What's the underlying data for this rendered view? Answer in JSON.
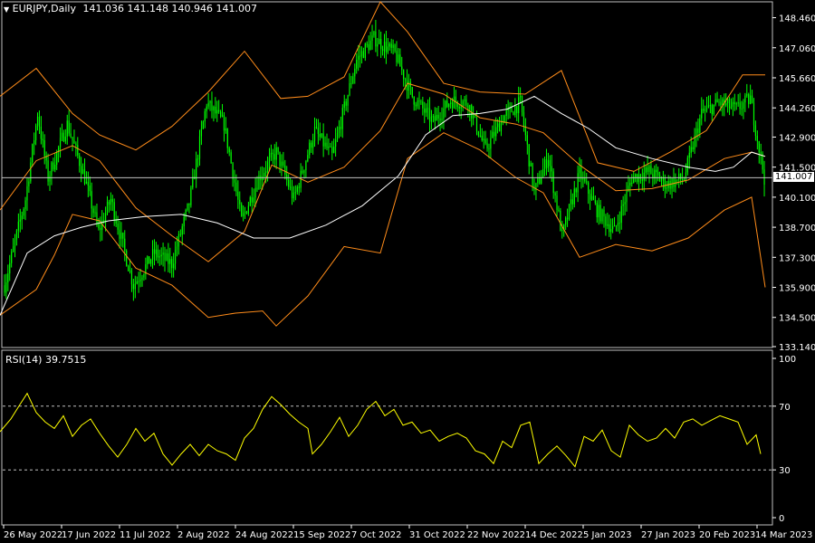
{
  "header": {
    "symbol": "EURJPY,Daily",
    "ohlc": "141.036 141.148 140.946 141.007"
  },
  "rsi_label": "RSI(14) 39.7515",
  "last_price": "141.007",
  "colors": {
    "background": "#000000",
    "candles": "#00ff00",
    "bands": "#ff8c1a",
    "ma": "#ffffff",
    "rsi": "#ffff00",
    "axis": "#ffffff",
    "levels": "#c0c0c0"
  },
  "chart_data": [
    {
      "type": "candlestick",
      "title": "EURJPY,Daily",
      "ylim": [
        133.14,
        149.2
      ],
      "y_ticks": [
        "148.460",
        "147.060",
        "145.660",
        "144.260",
        "142.900",
        "141.500",
        "140.100",
        "138.700",
        "137.300",
        "135.900",
        "134.500",
        "133.140"
      ],
      "x_labels": [
        "26 May 2022",
        "17 Jun 2022",
        "11 Jul 2022",
        "2 Aug 2022",
        "24 Aug 2022",
        "15 Sep 2022",
        "7 Oct 2022",
        "31 Oct 2022",
        "22 Nov 2022",
        "14 Dec 2022",
        "5 Jan 2023",
        "27 Jan 2023",
        "20 Feb 2023",
        "14 Mar 2023"
      ],
      "close_anchors": [
        [
          0,
          136.0
        ],
        [
          12,
          140.0
        ],
        [
          19,
          144.0
        ],
        [
          25,
          141.0
        ],
        [
          36,
          143.5
        ],
        [
          46,
          141.0
        ],
        [
          54,
          138.5
        ],
        [
          61,
          140.0
        ],
        [
          74,
          136.0
        ],
        [
          86,
          137.5
        ],
        [
          96,
          137.0
        ],
        [
          106,
          139.8
        ],
        [
          116,
          144.5
        ],
        [
          126,
          143.5
        ],
        [
          136,
          139.0
        ],
        [
          146,
          141.0
        ],
        [
          156,
          142.2
        ],
        [
          166,
          140.0
        ],
        [
          178,
          143.2
        ],
        [
          188,
          142.0
        ],
        [
          202,
          146.5
        ],
        [
          212,
          147.5
        ],
        [
          224,
          146.8
        ],
        [
          234,
          144.8
        ],
        [
          246,
          143.6
        ],
        [
          256,
          144.6
        ],
        [
          266,
          144.5
        ],
        [
          276,
          142.3
        ],
        [
          286,
          143.8
        ],
        [
          296,
          144.5
        ],
        [
          304,
          140.3
        ],
        [
          312,
          142.0
        ],
        [
          320,
          138.3
        ],
        [
          330,
          141.2
        ],
        [
          340,
          139.5
        ],
        [
          350,
          138.5
        ],
        [
          360,
          141.0
        ],
        [
          370,
          141.3
        ],
        [
          380,
          140.7
        ],
        [
          390,
          141.0
        ],
        [
          400,
          144.0
        ],
        [
          410,
          144.5
        ],
        [
          420,
          144.2
        ],
        [
          428,
          144.7
        ],
        [
          436,
          141.0
        ]
      ],
      "bands": {
        "upper": [
          [
            0,
            144.8
          ],
          [
            40,
            146.1
          ],
          [
            80,
            144.0
          ],
          [
            110,
            143.0
          ],
          [
            150,
            142.3
          ],
          [
            190,
            143.4
          ],
          [
            230,
            145.0
          ],
          [
            270,
            146.9
          ],
          [
            310,
            144.7
          ],
          [
            340,
            144.8
          ],
          [
            380,
            145.7
          ],
          [
            420,
            149.2
          ],
          [
            450,
            147.8
          ],
          [
            490,
            145.4
          ],
          [
            530,
            145.0
          ],
          [
            580,
            144.9
          ],
          [
            620,
            146.0
          ],
          [
            660,
            141.7
          ],
          [
            700,
            141.3
          ],
          [
            740,
            142.2
          ],
          [
            780,
            143.2
          ],
          [
            820,
            145.8
          ],
          [
            845,
            145.8
          ]
        ],
        "middle": [
          [
            0,
            139.5
          ],
          [
            40,
            141.8
          ],
          [
            80,
            142.5
          ],
          [
            110,
            141.8
          ],
          [
            150,
            139.6
          ],
          [
            190,
            138.3
          ],
          [
            230,
            137.1
          ],
          [
            270,
            138.5
          ],
          [
            300,
            141.6
          ],
          [
            340,
            140.8
          ],
          [
            380,
            141.5
          ],
          [
            420,
            143.2
          ],
          [
            450,
            145.4
          ],
          [
            490,
            144.9
          ],
          [
            530,
            143.8
          ],
          [
            570,
            143.5
          ],
          [
            600,
            143.1
          ],
          [
            640,
            141.6
          ],
          [
            680,
            140.4
          ],
          [
            720,
            140.5
          ],
          [
            760,
            140.9
          ],
          [
            800,
            141.9
          ],
          [
            830,
            142.2
          ],
          [
            845,
            142.0
          ]
        ],
        "lower": [
          [
            0,
            134.6
          ],
          [
            40,
            135.8
          ],
          [
            60,
            137.4
          ],
          [
            80,
            139.3
          ],
          [
            110,
            139.0
          ],
          [
            150,
            136.8
          ],
          [
            190,
            136.0
          ],
          [
            230,
            134.5
          ],
          [
            260,
            134.7
          ],
          [
            290,
            134.8
          ],
          [
            305,
            134.1
          ],
          [
            340,
            135.5
          ],
          [
            380,
            137.8
          ],
          [
            420,
            137.5
          ],
          [
            450,
            141.9
          ],
          [
            490,
            143.1
          ],
          [
            530,
            142.3
          ],
          [
            570,
            141.0
          ],
          [
            600,
            140.3
          ],
          [
            640,
            137.3
          ],
          [
            680,
            137.9
          ],
          [
            720,
            137.6
          ],
          [
            760,
            138.2
          ],
          [
            800,
            139.5
          ],
          [
            830,
            140.1
          ],
          [
            845,
            135.9
          ]
        ]
      },
      "ma": [
        [
          0,
          134.6
        ],
        [
          30,
          137.5
        ],
        [
          60,
          138.3
        ],
        [
          90,
          138.7
        ],
        [
          120,
          139.0
        ],
        [
          160,
          139.2
        ],
        [
          200,
          139.3
        ],
        [
          240,
          138.9
        ],
        [
          280,
          138.2
        ],
        [
          320,
          138.2
        ],
        [
          360,
          138.8
        ],
        [
          400,
          139.7
        ],
        [
          440,
          141.1
        ],
        [
          470,
          143.0
        ],
        [
          500,
          143.9
        ],
        [
          530,
          144.0
        ],
        [
          560,
          144.2
        ],
        [
          590,
          144.8
        ],
        [
          620,
          144.0
        ],
        [
          650,
          143.3
        ],
        [
          680,
          142.4
        ],
        [
          720,
          141.9
        ],
        [
          760,
          141.5
        ],
        [
          790,
          141.3
        ],
        [
          810,
          141.5
        ],
        [
          830,
          142.2
        ],
        [
          845,
          142.0
        ]
      ]
    },
    {
      "type": "line",
      "title": "RSI(14) 39.7515",
      "ylim": [
        0,
        100
      ],
      "y_ticks": [
        "100",
        "70",
        "30",
        "0"
      ],
      "levels": [
        70,
        30
      ],
      "rsi_anchors": [
        [
          0,
          54
        ],
        [
          12,
          62
        ],
        [
          22,
          71
        ],
        [
          30,
          78
        ],
        [
          40,
          66
        ],
        [
          50,
          60
        ],
        [
          60,
          56
        ],
        [
          70,
          64
        ],
        [
          80,
          51
        ],
        [
          90,
          58
        ],
        [
          100,
          62
        ],
        [
          110,
          53
        ],
        [
          120,
          45
        ],
        [
          130,
          38
        ],
        [
          140,
          46
        ],
        [
          150,
          56
        ],
        [
          160,
          48
        ],
        [
          170,
          53
        ],
        [
          180,
          40
        ],
        [
          190,
          33
        ],
        [
          200,
          40
        ],
        [
          210,
          46
        ],
        [
          220,
          39
        ],
        [
          230,
          46
        ],
        [
          240,
          42
        ],
        [
          250,
          40
        ],
        [
          260,
          36
        ],
        [
          270,
          50
        ],
        [
          280,
          56
        ],
        [
          290,
          68
        ],
        [
          300,
          76
        ],
        [
          310,
          71
        ],
        [
          320,
          65
        ],
        [
          330,
          60
        ],
        [
          340,
          56
        ],
        [
          345,
          40
        ],
        [
          355,
          46
        ],
        [
          365,
          54
        ],
        [
          375,
          63
        ],
        [
          385,
          51
        ],
        [
          395,
          58
        ],
        [
          405,
          68
        ],
        [
          415,
          73
        ],
        [
          425,
          64
        ],
        [
          435,
          68
        ],
        [
          445,
          58
        ],
        [
          455,
          60
        ],
        [
          465,
          53
        ],
        [
          475,
          55
        ],
        [
          485,
          48
        ],
        [
          495,
          51
        ],
        [
          505,
          53
        ],
        [
          515,
          50
        ],
        [
          525,
          42
        ],
        [
          535,
          40
        ],
        [
          545,
          34
        ],
        [
          555,
          48
        ],
        [
          565,
          44
        ],
        [
          575,
          58
        ],
        [
          585,
          60
        ],
        [
          595,
          34
        ],
        [
          605,
          40
        ],
        [
          615,
          45
        ],
        [
          625,
          39
        ],
        [
          635,
          32
        ],
        [
          645,
          51
        ],
        [
          655,
          48
        ],
        [
          665,
          55
        ],
        [
          675,
          42
        ],
        [
          685,
          38
        ],
        [
          695,
          58
        ],
        [
          705,
          52
        ],
        [
          715,
          48
        ],
        [
          725,
          50
        ],
        [
          735,
          56
        ],
        [
          745,
          50
        ],
        [
          755,
          60
        ],
        [
          765,
          62
        ],
        [
          775,
          58
        ],
        [
          785,
          61
        ],
        [
          795,
          64
        ],
        [
          805,
          62
        ],
        [
          815,
          60
        ],
        [
          825,
          46
        ],
        [
          835,
          52
        ],
        [
          840,
          40
        ]
      ]
    }
  ]
}
